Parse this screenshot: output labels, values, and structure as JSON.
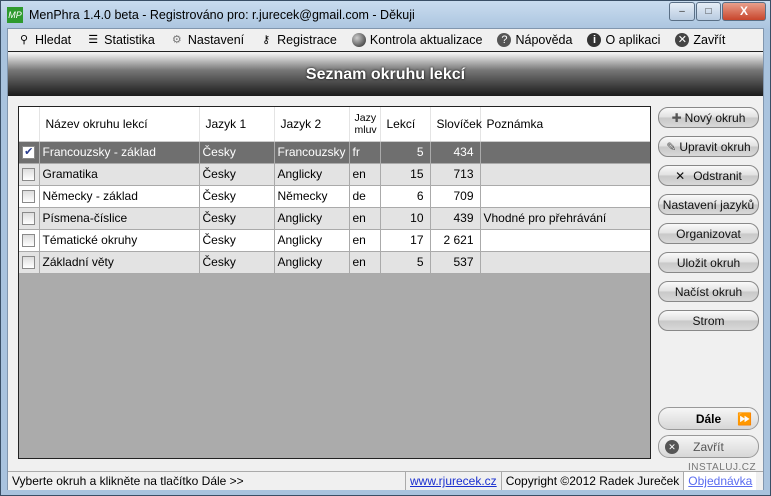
{
  "window": {
    "title": "MenPhra 1.4.0 beta - Registrováno pro: r.jurecek@gmail.com - Děkuji",
    "app_icon": "MP",
    "minimize": "–",
    "maximize": "□",
    "close": "X"
  },
  "menu": [
    {
      "label": "Hledat",
      "icon": "binoculars-icon"
    },
    {
      "label": "Statistika",
      "icon": "list-icon"
    },
    {
      "label": "Nastavení",
      "icon": "gear-icon"
    },
    {
      "label": "Registrace",
      "icon": "key-icon"
    },
    {
      "label": "Kontrola aktualizace",
      "icon": "globe-icon"
    },
    {
      "label": "Nápověda",
      "icon": "help-icon"
    },
    {
      "label": "O aplikaci",
      "icon": "info-icon"
    },
    {
      "label": "Zavřít",
      "icon": "close-icon"
    }
  ],
  "header": {
    "title": "Seznam okruhu lekcí"
  },
  "table": {
    "columns": [
      "Název okruhu lekcí",
      "Jazyk 1",
      "Jazyk 2",
      "Jazy mluv",
      "Lekcí",
      "Slovíček",
      "Poznámka"
    ],
    "rows": [
      {
        "checked": true,
        "name": "Francouzsky - základ",
        "lang1": "Česky",
        "lang2": "Francouzsky",
        "code": "fr",
        "lessons": "5",
        "words": "434",
        "note": ""
      },
      {
        "checked": false,
        "name": "Gramatika",
        "lang1": "Česky",
        "lang2": "Anglicky",
        "code": "en",
        "lessons": "15",
        "words": "713",
        "note": ""
      },
      {
        "checked": false,
        "name": "Německy - základ",
        "lang1": "Česky",
        "lang2": "Německy",
        "code": "de",
        "lessons": "6",
        "words": "709",
        "note": ""
      },
      {
        "checked": false,
        "name": "Písmena-číslice",
        "lang1": "Česky",
        "lang2": "Anglicky",
        "code": "en",
        "lessons": "10",
        "words": "439",
        "note": "Vhodné pro přehrávání"
      },
      {
        "checked": false,
        "name": "Tématické okruhy",
        "lang1": "Česky",
        "lang2": "Anglicky",
        "code": "en",
        "lessons": "17",
        "words": "2 621",
        "note": ""
      },
      {
        "checked": false,
        "name": "Základní věty",
        "lang1": "Česky",
        "lang2": "Anglicky",
        "code": "en",
        "lessons": "5",
        "words": "537",
        "note": ""
      }
    ]
  },
  "buttons": {
    "new": "Nový okruh",
    "edit": "Upravit okruh",
    "remove": "Odstranit",
    "lang_settings": "Nastavení jazyků",
    "organize": "Organizovat",
    "save": "Uložit okruh",
    "load": "Načíst okruh",
    "tree": "Strom",
    "next": "Dále",
    "close": "Zavřít"
  },
  "status": {
    "hint": "Vyberte okruh a klikněte na tlačítko Dále >>",
    "website": "www.rjurecek.cz",
    "copyright": "Copyright ©2012 Radek Jureček",
    "order": "Objednávka"
  },
  "watermark": "INSTALUJ.CZ"
}
